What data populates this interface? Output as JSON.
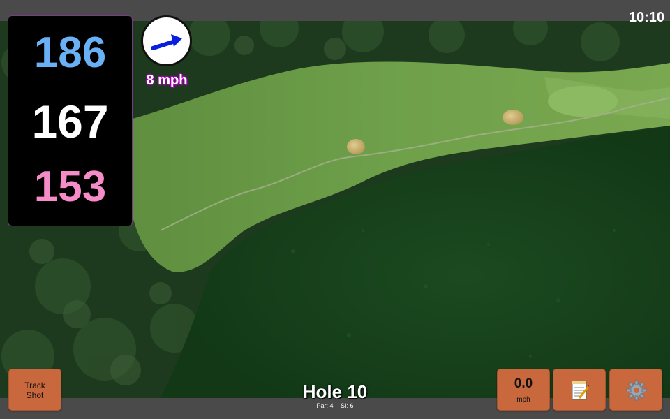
{
  "status_bar": {
    "clock": "10:10"
  },
  "distances": {
    "back": "186",
    "middle": "167",
    "front": "153"
  },
  "distance_colors": {
    "back": "#6ab0f5",
    "middle": "#ffffff",
    "front": "#f58cc8"
  },
  "wind": {
    "speed": "8 mph",
    "direction_icon": "arrow-up-right-icon"
  },
  "hole": {
    "title": "Hole 10",
    "par": "Par: 4",
    "si": "SI: 6"
  },
  "buttons": {
    "track_shot": "Track\nShot",
    "speed_value": "0.0",
    "speed_unit": "mph",
    "scorecard_icon": "notepad-icon",
    "settings_icon": "gear-icon"
  },
  "colors": {
    "button": "#c8683c",
    "frame": "#4a4a4a"
  }
}
